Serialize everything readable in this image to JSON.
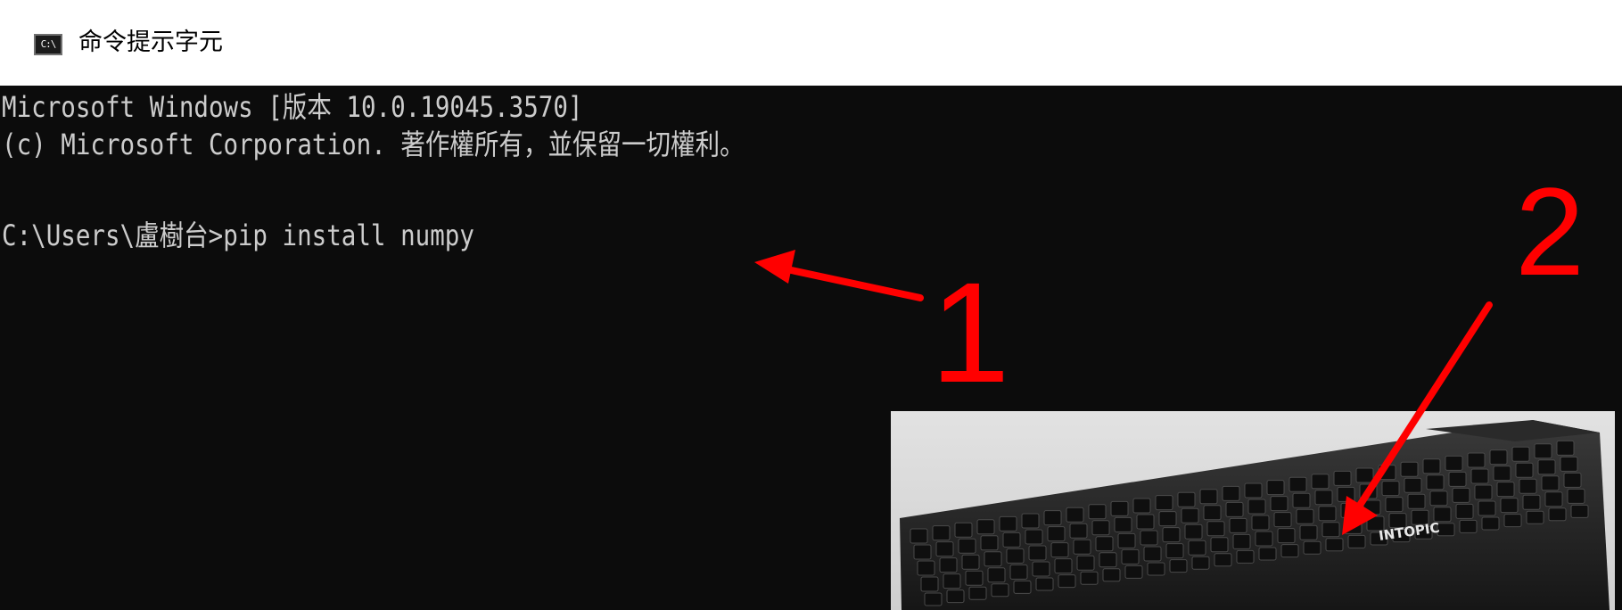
{
  "window": {
    "title": "命令提示字元",
    "icon_name": "cmd-icon",
    "icon_text": "C:\\"
  },
  "console": {
    "lines": [
      "Microsoft Windows [版本 10.0.19045.3570]",
      "(c) Microsoft Corporation. 著作權所有，並保留一切權利。",
      "C:\\Users\\盧樹台>pip install numpy"
    ]
  },
  "keyboard": {
    "brand": "INTOPIC"
  },
  "annotations": {
    "label_1": "1",
    "label_2": "2",
    "color": "#ff0000"
  }
}
